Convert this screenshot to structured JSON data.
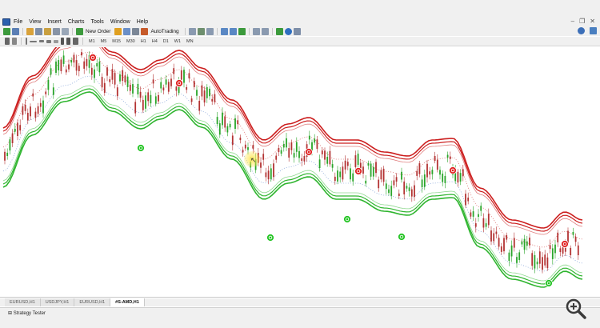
{
  "menu": {
    "items": [
      "File",
      "View",
      "Insert",
      "Charts",
      "Tools",
      "Window",
      "Help"
    ]
  },
  "toolbar": {
    "new_order_label": "New Order",
    "autotrading_label": "AutoTrading"
  },
  "timeframes": [
    "M1",
    "M5",
    "M15",
    "M30",
    "H1",
    "H4",
    "D1",
    "W1",
    "MN"
  ],
  "tabs": [
    "EURUSD,H1",
    "USDJPY,H1",
    "EURUSD,H1",
    "#S-AMD,H1"
  ],
  "active_tab_index": 3,
  "status": {
    "strategy_tester_label": "Strategy Tester"
  },
  "colors": {
    "bull_candle": "#2aa52a",
    "bear_candle": "#b33333",
    "upper_band": "#cc1f1f",
    "lower_band": "#2fb52f",
    "signal_sell": "#e02020",
    "signal_buy": "#22c422"
  }
}
